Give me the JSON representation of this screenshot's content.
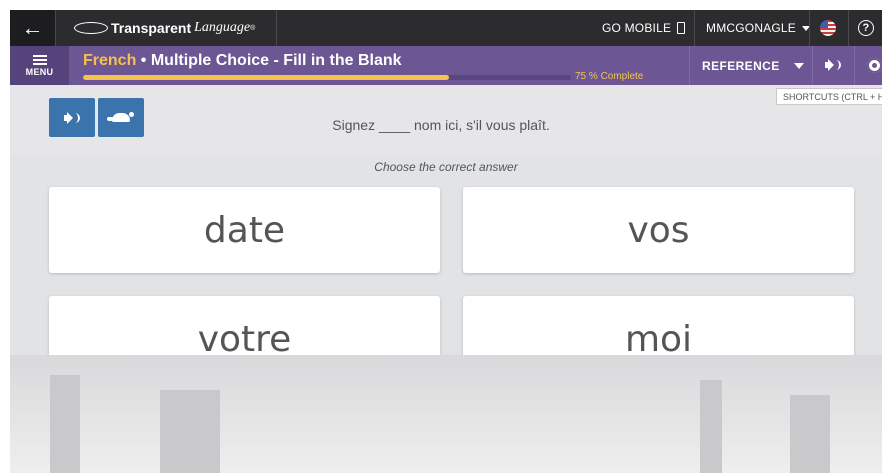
{
  "topbar": {
    "back_glyph": "←",
    "brand_bold": "Transparent",
    "brand_italic": "Language",
    "brand_mark": "®",
    "go_mobile": "GO MOBILE",
    "username": "MMCGONAGLE",
    "help_glyph": "?"
  },
  "lesson": {
    "menu_label": "MENU",
    "language": "French",
    "title_sep": " • ",
    "activity": "Multiple Choice - Fill in the Blank",
    "progress_percent": 75,
    "progress_text": "75 % Complete",
    "reference_label": "REFERENCE",
    "shortcuts_tooltip": "SHORTCUTS (CTRL + H"
  },
  "prompt": {
    "sentence": "Signez ____ nom ici, s'il vous plaît."
  },
  "answers": {
    "instruction": "Choose the correct answer",
    "choices": [
      "date",
      "vos",
      "votre",
      "moi"
    ]
  },
  "colors": {
    "topbar": "#2c2c2e",
    "lessonbar": "#6c5693",
    "accent_gold": "#f3c24f",
    "audio_button": "#3b73ad"
  },
  "icons": [
    "back-arrow-icon",
    "brand-swoosh-icon",
    "phone-icon",
    "dropdown-caret-icon",
    "us-flag-icon",
    "help-icon",
    "menu-hamburger-icon",
    "reference-dropdown-icon",
    "speaker-icon",
    "gear-icon",
    "turtle-icon"
  ]
}
